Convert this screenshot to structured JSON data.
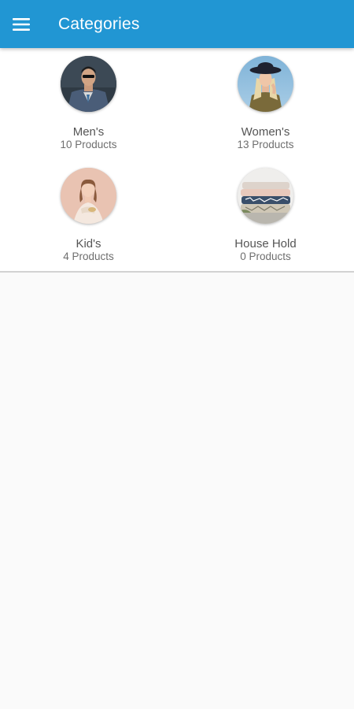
{
  "app_bar": {
    "title": "Categories",
    "menu_icon": "hamburger-menu-icon",
    "color": "#2196d3"
  },
  "categories": [
    {
      "name": "Men's",
      "count": "10 Products",
      "image": "man-in-suit-photo"
    },
    {
      "name": "Women's",
      "count": "13 Products",
      "image": "woman-in-hat-photo"
    },
    {
      "name": "Kid's",
      "count": "4 Products",
      "image": "girl-in-dress-photo"
    },
    {
      "name": "House Hold",
      "count": "0 Products",
      "image": "folded-textiles-photo"
    }
  ]
}
